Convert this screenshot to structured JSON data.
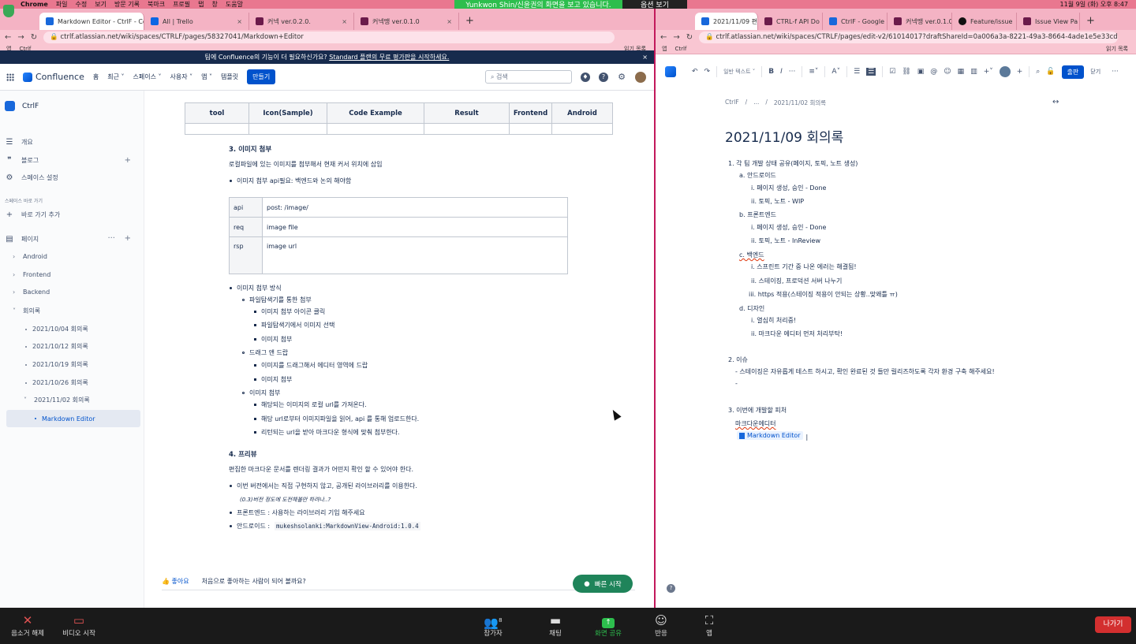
{
  "menubar": {
    "app": "Chrome",
    "items": [
      "파일",
      "수정",
      "보기",
      "방문 기록",
      "북마크",
      "프로필",
      "탭",
      "창",
      "도움말"
    ],
    "clock": "11월 9일 (화) 오후 8:47"
  },
  "zoom_overlay": {
    "sharing_text": "Yunkwon Shin/신윤권의 화면을 보고 있습니다.",
    "view_options": "옵션 보기"
  },
  "left_browser": {
    "tabs": [
      {
        "label": "Markdown Editor - CtrlF - Conf",
        "icon": "confluence-icon"
      },
      {
        "label": "All | Trello",
        "icon": "trello-icon"
      },
      {
        "label": "커넥 ver.0.2.0.",
        "icon": "notion-icon"
      },
      {
        "label": "커넥땡 ver.0.1.0",
        "icon": "notion-icon"
      }
    ],
    "url": "ctrlf.atlassian.net/wiki/spaces/CTRLF/pages/58327041/Markdown+Editor",
    "bookmarks": [
      "앱",
      "Ctrlf"
    ],
    "bookmarks_right": "읽기 목록"
  },
  "banner": {
    "text": "팀에 Confluence의 기능이 더 필요하신가요?",
    "link": "Standard 플랜의 무료 평가판을 시작하세요."
  },
  "topnav": {
    "logo": "Confluence",
    "items": [
      "홈",
      "최근 ˅",
      "스페이스 ˅",
      "사용자 ˅",
      "앱 ˅",
      "템플릿"
    ],
    "create": "만들기",
    "search_placeholder": "검색"
  },
  "sidebar": {
    "space_name": "CtrlF",
    "items": [
      {
        "label": "개요",
        "icon": "overview-icon"
      },
      {
        "label": "블로그",
        "icon": "quote-icon"
      },
      {
        "label": "스페이스 설정",
        "icon": "gear-icon"
      }
    ],
    "shortcut_heading": "스페이스 바로 가기",
    "add_shortcut": "바로 가기 추가",
    "pages_label": "페이지",
    "tree": [
      {
        "label": "Android"
      },
      {
        "label": "Frontend"
      },
      {
        "label": "Backend"
      },
      {
        "label": "회의록"
      },
      {
        "label": "2021/10/04 회의록"
      },
      {
        "label": "2021/10/12 회의록"
      },
      {
        "label": "2021/10/19 회의록"
      },
      {
        "label": "2021/10/26 회의록"
      },
      {
        "label": "2021/11/02 회의록"
      },
      {
        "label": "Markdown Editor"
      }
    ]
  },
  "content": {
    "table_headers": [
      "tool",
      "Icon(Sample)",
      "Code Example",
      "Result",
      "Frontend",
      "Android"
    ],
    "section3_title": "3. 이미지 첨부",
    "section3_desc": "로컬파일에 있는 이미지를 첨부해서 현재 커서 위치에 삽입",
    "api_bullet": "이미지 첨부 api필요: 백엔드와 논의 해야함",
    "api_table": [
      [
        "api",
        "post: /image/"
      ],
      [
        "req",
        "image file"
      ],
      [
        "rsp",
        "image url"
      ]
    ],
    "bullets": [
      {
        "level": 1,
        "text": "이미지 첨부 방식"
      },
      {
        "level": 2,
        "text": "파일탐색기를 통한 첨부"
      },
      {
        "level": 3,
        "text": "이미지 첨부 아이콘 클릭"
      },
      {
        "level": 3,
        "text": "파일탐색기에서 이미지 선택"
      },
      {
        "level": 3,
        "text": "이미지 첨부"
      },
      {
        "level": 2,
        "text": "드래그 앤 드랍"
      },
      {
        "level": 3,
        "text": "이미지를 드래그해서 에디터 영역에 드랍"
      },
      {
        "level": 3,
        "text": "이미지 첨부"
      },
      {
        "level": 2,
        "text": "이미지 첨부"
      },
      {
        "level": 3,
        "text": "해당되는 이미지의 로컬 url를 가져온다."
      },
      {
        "level": 3,
        "text": "해당 url로부터 이미지파일을 읽어, api 를 통해 업로드한다."
      },
      {
        "level": 3,
        "text": "리턴되는 url을 받아 마크다운 형식에 맞춰 첨부한다."
      }
    ],
    "section4_title": "4. 프리뷰",
    "section4_desc": "편집한 마크다운 문서를 렌더링 결과가 어떤지 확인 할 수 있어야 한다.",
    "preview_bullets": [
      "이번 버전에서는 직접 구현하지 않고, 공개된 라이브러리를 이용한다.",
      "프론트엔드 : 사용하는 라이브러리 기입 해주세요",
      "안드로이드 :"
    ],
    "preview_note": "(0.3)버전 정도에 도전해볼만 하려나..?",
    "android_lib": "mukeshsolanki:MarkdownView-Android:1.0.4",
    "like_label": "좋아요",
    "like_prompt": "처음으로 좋아하는 사람이 되어 볼까요?",
    "quickstart": "빠른 시작"
  },
  "right_browser": {
    "tabs": [
      {
        "label": "2021/11/09 편집",
        "icon": "confluence-icon"
      },
      {
        "label": "CTRL-f API Do",
        "icon": "notion-icon"
      },
      {
        "label": "CtrlF - Google",
        "icon": "confluence-icon"
      },
      {
        "label": "커넥땡 ver.0.1.0",
        "icon": "notion-icon"
      },
      {
        "label": "Feature/issue",
        "icon": "github-icon"
      },
      {
        "label": "Issue View Pa",
        "icon": "notion-icon"
      }
    ],
    "url": "ctrlf.atlassian.net/wiki/spaces/CTRLF/pages/edit-v2/61014017?draftShareId=0a006a3a-8221-49a3-8664-4ade1e5e33cd",
    "bookmarks": [
      "앱",
      "Ctrlf"
    ],
    "bookmarks_right": "읽기 목록",
    "toolbar": {
      "text_style": "일반 텍스트 ˅",
      "publish": "출판",
      "close": "닫기"
    },
    "breadcrumb": [
      "CtrlF",
      "/",
      "...",
      "/",
      "2021/11/02 회의록"
    ],
    "title": "2021/11/09 회의록",
    "lines": [
      "1. 각 팀 개발 상태 공유(페이지, 토픽, 노트 생성)",
      "a. 안드로이드",
      "i. 페이지 생성, 승인 - Done",
      "ii. 토픽, 노트 - WIP",
      "b. 프론트엔드",
      "i. 페이지 생성, 승인 - Done",
      "ii. 토픽, 노트 - InReview",
      "c. 백엔드",
      "i. 스프린트 기간 중 나온 에러는 해결됨!",
      "ii. 스테이징, 프로덕션 서버 나누기",
      "iii. https 적용(스테이징 적용이 안되는 상황..맞왜틀 ㅠ)",
      "d. 디자인",
      "i. 열심히 처리중!",
      "ii. 마크다운 에디터 먼저 처리부탁!",
      "2. 이슈",
      "- 스테이징은 자유롭게 테스트 하시고, 확인 완료된 것 들만 릴리즈하도록 각자 환경 구축 해주세요!",
      "-",
      "3. 이번에 개발할 피처",
      "마크다운에디터"
    ],
    "page_link": "Markdown Editor"
  },
  "zoom_bar": {
    "mute": "음소거 해제",
    "video": "비디오 시작",
    "participants": "참가자",
    "participant_count": "8",
    "chat": "채팅",
    "share": "화면 공유",
    "reactions": "반응",
    "apps": "앱",
    "leave": "나가기"
  }
}
